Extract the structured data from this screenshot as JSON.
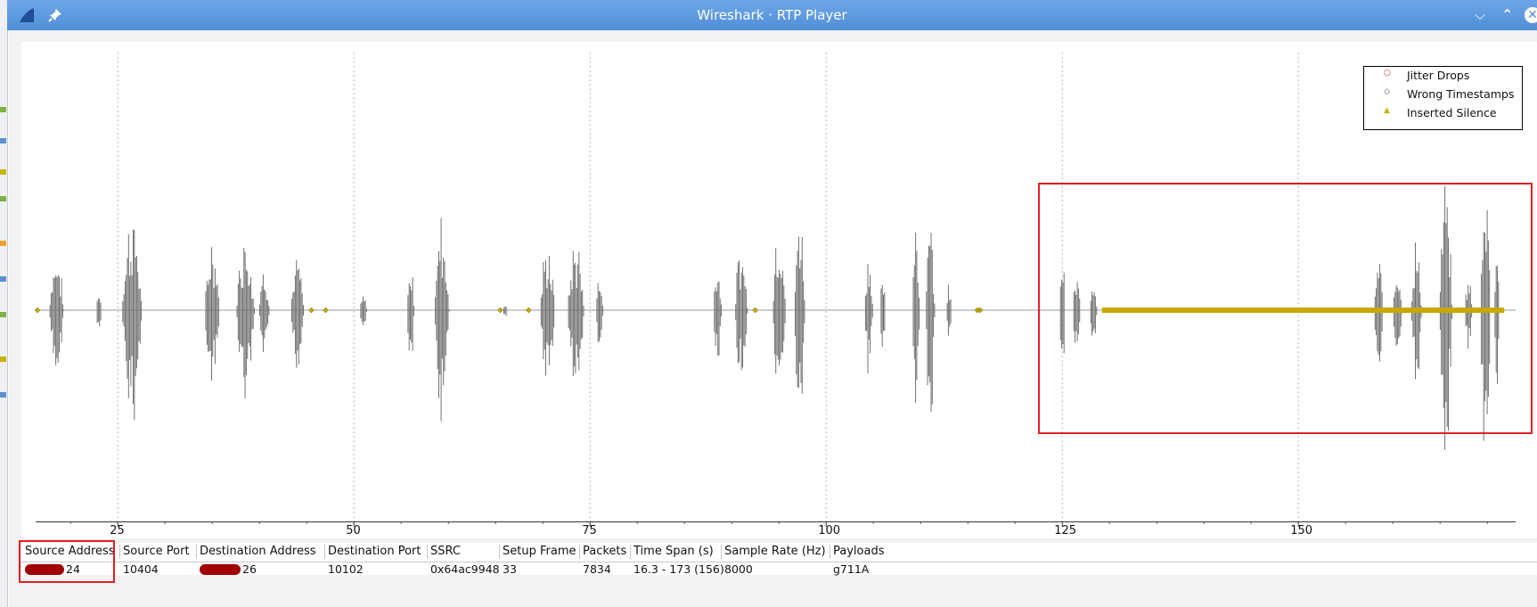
{
  "window": {
    "title": "Wireshark · RTP Player",
    "minimize_symbol": "⌵",
    "maximize_symbol": "⌃",
    "close_symbol": "✕",
    "app_icon": "shark-fin-icon",
    "pin_icon": "pin-icon"
  },
  "legend": {
    "items": [
      {
        "label": "Jitter Drops",
        "symbol": "○",
        "color": "#d02020"
      },
      {
        "label": "Wrong Timestamps",
        "symbol": "◇",
        "color": "#404080"
      },
      {
        "label": "Inserted Silence",
        "symbol": "▲",
        "color": "#c8b400"
      }
    ]
  },
  "axis": {
    "ticks": [
      "25",
      "50",
      "75",
      "100",
      "125",
      "150"
    ]
  },
  "chart_data": {
    "type": "line",
    "x_ticks": [
      25,
      50,
      75,
      100,
      125,
      150
    ],
    "xlim": [
      16.3,
      173
    ],
    "grid": true,
    "legend_position": "top-right",
    "waveform_color": "#6e7072",
    "silence_color": "#c8a800",
    "series": [
      {
        "name": "Inserted Silence",
        "x_range": [
          129.2,
          171.8
        ]
      }
    ]
  },
  "table": {
    "headers": [
      "Source Address",
      "Source Port",
      "Destination Address",
      "Destination Port",
      "SSRC",
      "Setup Frame",
      "Packets",
      "Time Span (s)",
      "Sample Rate (Hz)",
      "Payloads"
    ],
    "row": {
      "source_address": "24",
      "source_port": "10404",
      "destination_address": "26",
      "destination_port": "10102",
      "ssrc": "0x64ac9948",
      "setup_frame": "33",
      "packets": "7834",
      "time_span": "16.3 - 173 (156)",
      "sample_rate": "8000",
      "payloads": "g711A"
    }
  },
  "colors": {
    "titlebar": "#5b9be0",
    "highlight": "#e02020"
  }
}
